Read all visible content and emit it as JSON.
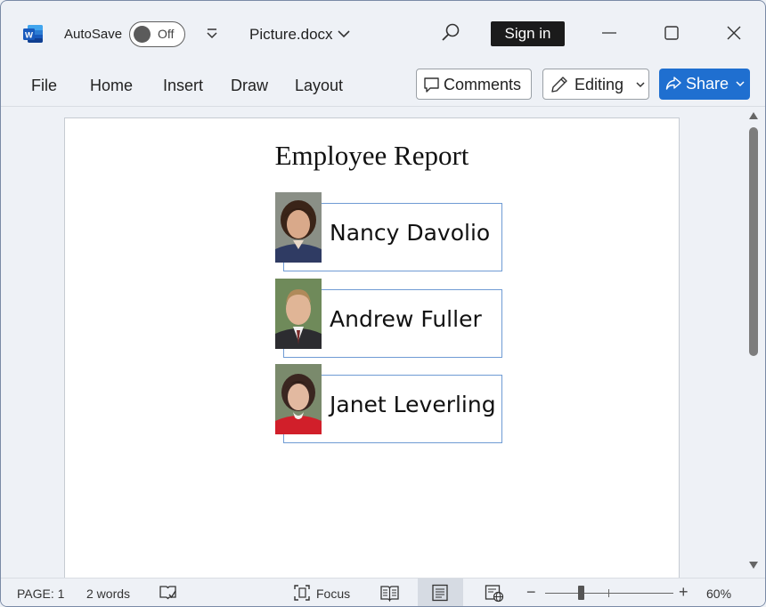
{
  "titlebar": {
    "autosave_label": "AutoSave",
    "autosave_state": "Off",
    "document_name": "Picture.docx",
    "signin_label": "Sign in"
  },
  "ribbon": {
    "tabs": [
      "File",
      "Home",
      "Insert",
      "Draw",
      "Layout"
    ],
    "comments_label": "Comments",
    "editing_label": "Editing",
    "share_label": "Share"
  },
  "document": {
    "title": "Employee Report",
    "employees": [
      {
        "name": "Nancy Davolio"
      },
      {
        "name": "Andrew Fuller"
      },
      {
        "name": "Janet Leverling"
      }
    ]
  },
  "statusbar": {
    "page": "PAGE: 1",
    "words": "2 words",
    "focus": "Focus",
    "zoom": "60%",
    "zoom_level": 0.6
  },
  "colors": {
    "accent": "#1f6fd0",
    "card_border": "#6f9bd4",
    "signin_bg": "#1b1b1b",
    "word_brand": "#185abd"
  },
  "icons": [
    "word-logo-icon",
    "toggle",
    "customize-qat-icon",
    "chevron-down-icon",
    "search-icon",
    "minimize-icon",
    "maximize-icon",
    "close-icon",
    "comment-icon",
    "pencil-icon",
    "share-icon",
    "proofing-icon",
    "focus-icon",
    "read-mode-icon",
    "print-layout-icon",
    "web-layout-icon"
  ]
}
